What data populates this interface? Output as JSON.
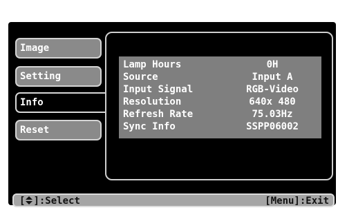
{
  "menu": {
    "tabs": [
      {
        "label": "Image"
      },
      {
        "label": "Setting"
      },
      {
        "label": "Info"
      },
      {
        "label": "Reset"
      }
    ],
    "active_tab": "Info"
  },
  "info": {
    "rows": [
      {
        "label": "Lamp Hours",
        "value": "0H"
      },
      {
        "label": "Source",
        "value": "Input A"
      },
      {
        "label": "Input Signal",
        "value": "RGB-Video"
      },
      {
        "label": "Resolution",
        "value": "640x 480"
      },
      {
        "label": "Refresh Rate",
        "value": "75.03Hz"
      },
      {
        "label": "Sync Info",
        "value": "SSPP06002"
      }
    ]
  },
  "statusbar": {
    "select_open": "[",
    "select_icon": "up-down-arrow-icon",
    "select_text": "]:Select",
    "exit_text": "[Menu]:Exit"
  },
  "colors": {
    "background": "#000000",
    "tab_inactive": "#8a8a8a",
    "info_panel": "#7f7f7f",
    "statusbar": "#a5a5a5"
  }
}
